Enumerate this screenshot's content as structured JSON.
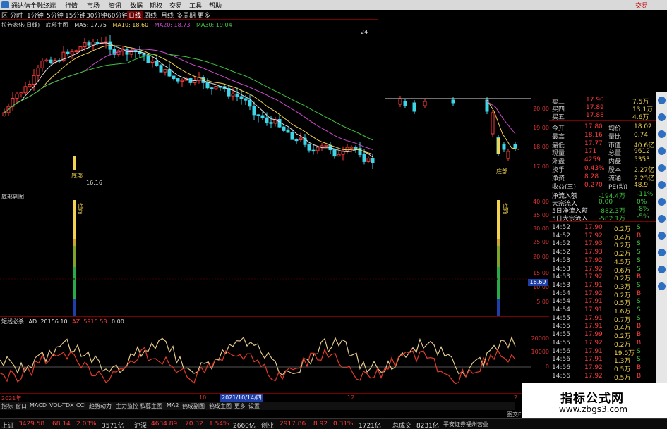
{
  "titlebar": {
    "app_name": "通达信金融终端",
    "menu": [
      "行情",
      "市场",
      "资讯",
      "数据",
      "期权",
      "交易",
      "工具",
      "帮助"
    ],
    "brand": "交易"
  },
  "toolbar": {
    "items": [
      "区",
      "分时",
      "1分钟",
      "5分钟",
      "15分钟",
      "30分钟",
      "60分钟",
      "日线",
      "周线",
      "月线",
      "多周期",
      "更多"
    ],
    "active": "日线"
  },
  "main_chart": {
    "header": "拉芳家化(日线)",
    "indicator": "底部主图",
    "ma": [
      {
        "label": "MA5: 17.75",
        "color": "#e0e0e0"
      },
      {
        "label": "MA10: 18.60",
        "color": "#f2d34f"
      },
      {
        "label": "MA20: 18.73",
        "color": "#d04ad0"
      },
      {
        "label": "MA30: 19.04",
        "color": "#3ec43e"
      }
    ],
    "price_hi": "24",
    "price_lo": "16.16",
    "marker_left": "底部",
    "marker_right": "底部",
    "axis": [
      "20.00",
      "19.00",
      "18.00",
      "17.00"
    ]
  },
  "sub1": {
    "header": "底部副图",
    "label_top": "底部",
    "axis": [
      "40.00",
      "35.00",
      "30.00",
      "25.00",
      "20.00",
      "15.00",
      "10.00",
      "5.00"
    ],
    "current": "16.69"
  },
  "sub2": {
    "header": "短线必杀",
    "ad": "AD: 20156.10",
    "az": "AZ: 5915.58",
    "zero": "0.00",
    "axis": [
      "20000",
      "10000",
      "0"
    ]
  },
  "date_axis": {
    "left": "2021年",
    "mid": "10",
    "highlight": "2021/10/14/四",
    "right1": "12",
    "right2": "2"
  },
  "quote": {
    "sell3": {
      "label": "卖三",
      "price": "17.90",
      "vol": "7.5万"
    },
    "buy4": {
      "label": "买四",
      "price": "17.89",
      "vol": "13.1万"
    },
    "buy5": {
      "label": "买五",
      "price": "17.88",
      "vol": "4.6万"
    },
    "stats": [
      {
        "l1": "今开",
        "v1": "17.80",
        "l2": "均价",
        "v2": "18.02"
      },
      {
        "l1": "最高",
        "v1": "18.16",
        "l2": "量比",
        "v2": "0.74"
      },
      {
        "l1": "最低",
        "v1": "17.77",
        "l2": "市值",
        "v2": "40.6亿"
      },
      {
        "l1": "现量",
        "v1": "171",
        "l2": "总量",
        "v2": "9612"
      },
      {
        "l1": "外盘",
        "v1": "4259",
        "l2": "内盘",
        "v2": "5353"
      },
      {
        "l1": "换手",
        "v1": "0.43%",
        "l2": "股本",
        "v2": "2.27亿"
      },
      {
        "l1": "净资",
        "v1": "8.28",
        "l2": "流通",
        "v2": "2.23亿"
      },
      {
        "l1": "收益(三)",
        "v1": "0.270",
        "l2": "PE(动)",
        "v2": "48.9"
      }
    ],
    "flows": [
      {
        "label": "净流入额",
        "value": "-194.4万",
        "pct": "-11%"
      },
      {
        "label": "大宗流入",
        "value": "0.00",
        "pct": "0%"
      },
      {
        "label": "5日净流入额",
        "value": "-882.3万",
        "pct": "-8%"
      },
      {
        "label": "5日大宗流入",
        "value": "-582.1万",
        "pct": "-5%"
      }
    ],
    "ticks": [
      [
        "14:52",
        "17.90",
        "0.2万",
        "S"
      ],
      [
        "14:52",
        "17.92",
        "0.4万",
        "B"
      ],
      [
        "14:52",
        "17.93",
        "0.2万",
        "S"
      ],
      [
        "14:52",
        "17.93",
        "0.2万",
        "S"
      ],
      [
        "14:53",
        "17.92",
        "4.5万",
        "S"
      ],
      [
        "14:53",
        "17.92",
        "0.6万",
        "S"
      ],
      [
        "14:53",
        "17.92",
        "0.2万",
        "B"
      ],
      [
        "14:53",
        "17.91",
        "0.3万",
        "S"
      ],
      [
        "14:54",
        "17.92",
        "0.2万",
        "B"
      ],
      [
        "14:54",
        "17.91",
        "0.5万",
        "S"
      ],
      [
        "14:54",
        "17.91",
        "1.6万",
        "S"
      ],
      [
        "14:55",
        "17.91",
        "0.7万",
        "S"
      ],
      [
        "14:55",
        "17.91",
        "0.4万",
        "B"
      ],
      [
        "14:55",
        "17.99",
        "0.2万",
        "B"
      ],
      [
        "14:55",
        "17.92",
        "0.2万",
        "B"
      ],
      [
        "14:56",
        "17.91",
        "19.0万",
        "S"
      ],
      [
        "14:56",
        "17.91",
        "1.3万",
        "S"
      ],
      [
        "14:56",
        "17.92",
        "0.5万",
        "B"
      ],
      [
        "14:56",
        "17.92",
        "0.5万",
        "B"
      ]
    ]
  },
  "bottom_tabs": [
    "指标",
    "窗口",
    "MACD",
    "VOL-TDX",
    "CCI",
    "趋势动力",
    "主力监控",
    "私募主图",
    "MA2",
    "鹤成副图",
    "鹤成主图",
    "更多",
    "设置"
  ],
  "bottom_right": "图交F10",
  "status": {
    "sh_label": "上证",
    "sh_val": "3429.58",
    "sh_chg": "68.14",
    "sh_pct": "2.03%",
    "sh_amt": "3571亿",
    "sz_label": "沪深",
    "sz_val": "4634.89",
    "sz_chg": "70.32",
    "sz_pct": "1.54%",
    "sz_amt": "2660亿",
    "cy_label": "创业",
    "cy_val": "2917.86",
    "cy_chg": "8.92",
    "cy_pct": "0.31%",
    "cy_amt": "1721亿",
    "total_label": "总成交",
    "total_val": "8231亿",
    "broker": "平安证券福州营业"
  },
  "watermark": {
    "title": "指标公式网",
    "url": "www.zbgs3.com"
  },
  "colors": {
    "up": "#ff3b3b",
    "down": "#3fd5e8",
    "grid": "#7a0000",
    "ma5": "#e0e0e0",
    "ma10": "#f2d34f",
    "ma20": "#d04ad0",
    "ma30": "#3ec43e"
  }
}
